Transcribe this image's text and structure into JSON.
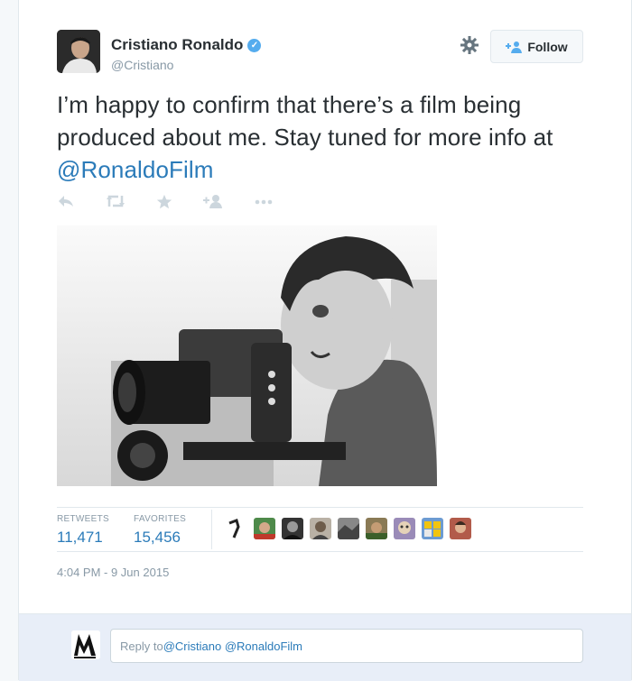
{
  "tweet": {
    "author_name": "Cristiano Ronaldo",
    "author_handle": "@Cristiano",
    "verified_icon": "verified-badge-icon",
    "text_before": "I’m happy to confirm that there’s a film being produced about me. Stay tuned for more info at ",
    "text_mention": "@RonaldoFilm",
    "follow_label": "Follow",
    "timestamp": "4:04 PM - 9 Jun 2015"
  },
  "actions": [
    {
      "name": "reply-icon"
    },
    {
      "name": "retweet-icon"
    },
    {
      "name": "favorite-icon"
    },
    {
      "name": "follow-icon"
    },
    {
      "name": "more-icon"
    }
  ],
  "stats": {
    "retweets_label": "RETWEETS",
    "retweets_value": "11,471",
    "favorites_label": "FAVORITES",
    "favorites_value": "15,456"
  },
  "favoriters_count_shown": 9,
  "reply": {
    "prefix": "Reply to ",
    "mention1": "@Cristiano",
    "mention2": "@RonaldoFilm"
  },
  "colors": {
    "link": "#2b7bb9",
    "muted": "#8899a6",
    "verified": "#55acee"
  }
}
